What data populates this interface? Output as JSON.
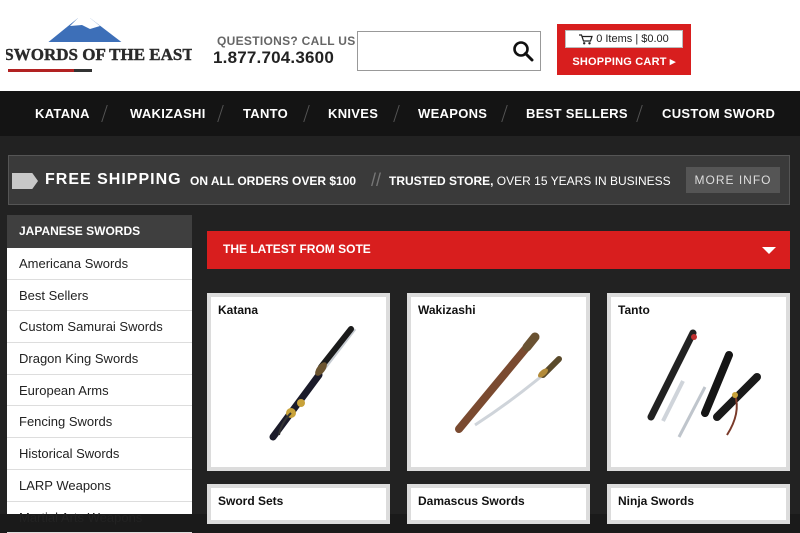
{
  "header": {
    "logo_text": "SWORDS OF THE EAST",
    "questions_label": "QUESTIONS? CALL US",
    "phone": "1.877.704.3600",
    "search": {
      "placeholder": ""
    },
    "cart": {
      "summary": "0 Items | $0.00",
      "link_label": "SHOPPING CART ▸"
    }
  },
  "nav": {
    "items": [
      {
        "label": "KATANA"
      },
      {
        "label": "WAKIZASHI"
      },
      {
        "label": "TANTO"
      },
      {
        "label": "KNIVES"
      },
      {
        "label": "WEAPONS"
      },
      {
        "label": "BEST SELLERS"
      },
      {
        "label": "CUSTOM SWORD"
      }
    ]
  },
  "banner": {
    "free_shipping": "FREE SHIPPING",
    "orders": "ON ALL ORDERS OVER $100",
    "trusted_bold": "TRUSTED STORE,",
    "trusted_rest": " OVER 15 YEARS IN BUSINESS",
    "more_info": "MORE INFO"
  },
  "sidebar": {
    "heading": "JAPANESE SWORDS",
    "items": [
      {
        "label": "Americana Swords"
      },
      {
        "label": "Best Sellers"
      },
      {
        "label": "Custom Samurai Swords"
      },
      {
        "label": "Dragon King Swords"
      },
      {
        "label": "European Arms"
      },
      {
        "label": "Fencing Swords"
      },
      {
        "label": "Historical Swords"
      },
      {
        "label": "LARP Weapons"
      },
      {
        "label": "Martial Arts Weapons"
      }
    ]
  },
  "main": {
    "latest_title": "THE LATEST FROM SOTE",
    "cards": [
      {
        "title": "Katana"
      },
      {
        "title": "Wakizashi"
      },
      {
        "title": "Tanto"
      },
      {
        "title": "Sword Sets"
      },
      {
        "title": "Damascus Swords"
      },
      {
        "title": "Ninja Swords"
      }
    ]
  },
  "colors": {
    "accent": "#d81e1e",
    "nav_bg": "#141414",
    "sidebar_head": "#3f3f3f"
  }
}
